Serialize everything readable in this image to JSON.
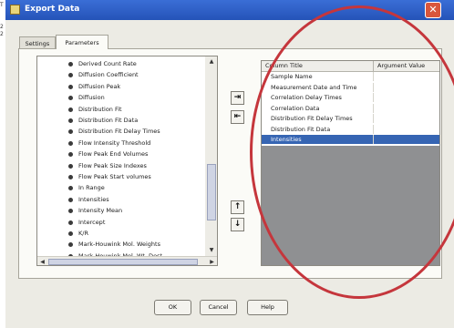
{
  "window": {
    "title": "Export Data",
    "close_label": "✕"
  },
  "side_numbers": [
    "T",
    "2",
    "2"
  ],
  "tabs": [
    {
      "label": "Settings",
      "selected": false
    },
    {
      "label": "Parameters",
      "selected": true
    }
  ],
  "parameters": {
    "items": [
      "Derived Count Rate",
      "Diffusion Coefficient",
      "Diffusion Peak",
      "Diffusion",
      "Distribution Fit",
      "Distribution Fit Data",
      "Distribution Fit Delay Times",
      "Flow Intensity Threshold",
      "Flow Peak End Volumes",
      "Flow Peak Size Indexes",
      "Flow Peak Start volumes",
      "In Range",
      "Intensities",
      "Intensity Mean",
      "Intercept",
      "K/R",
      "Mark-Houwink Mol. Weights",
      "Mark-Houwink Mol. Wt. Dest"
    ]
  },
  "arrow_buttons": {
    "add": "⇥",
    "remove": "⇤",
    "move_up": "↑",
    "move_down": "↓"
  },
  "grid": {
    "columns": [
      "Column Title",
      "Argument Value"
    ],
    "rows": [
      {
        "title": "Sample Name",
        "value": ""
      },
      {
        "title": "Measurement Date and Time",
        "value": ""
      },
      {
        "title": "Correlation Delay Times",
        "value": ""
      },
      {
        "title": "Correlation Data",
        "value": ""
      },
      {
        "title": "Distribution Fit Delay Times",
        "value": ""
      },
      {
        "title": "Distribution Fit Data",
        "value": ""
      },
      {
        "title": "Intensities",
        "value": ""
      }
    ],
    "selected_index": 6
  },
  "scroll": {
    "up": "▲",
    "down": "▼",
    "left": "◀",
    "right": "▶",
    "list_scroll_position": 0.55
  },
  "footer": {
    "ok": "OK",
    "cancel": "Cancel",
    "help": "Help"
  },
  "colors": {
    "title_bar": "#2553b8",
    "selection": "#3665b3",
    "annotation_circle": "#c5363c"
  }
}
